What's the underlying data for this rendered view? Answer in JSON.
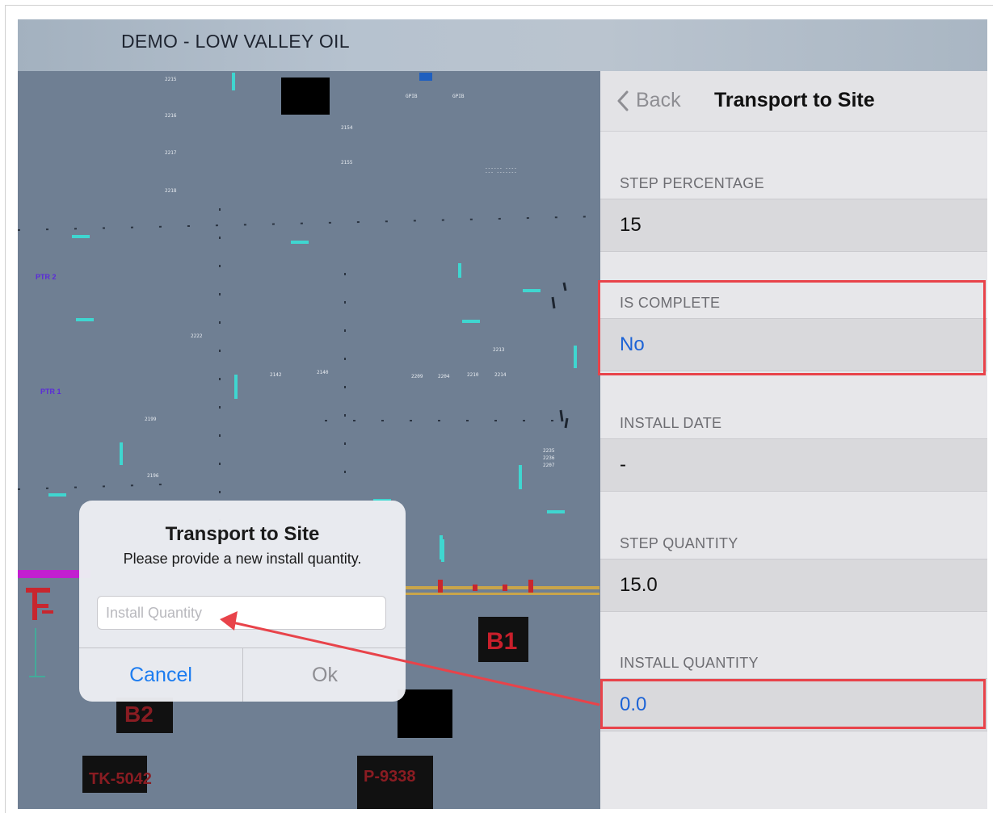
{
  "app": {
    "title": "DEMO - LOW VALLEY OIL"
  },
  "nav": {
    "back_label": "Back",
    "title": "Transport to Site"
  },
  "sections": [
    {
      "header": "STEP PERCENTAGE",
      "value": "15"
    },
    {
      "header": "IS COMPLETE",
      "value": "No"
    },
    {
      "header": "INSTALL DATE",
      "value": "-"
    },
    {
      "header": "STEP QUANTITY",
      "value": "15.0"
    },
    {
      "header": "INSTALL QUANTITY",
      "value": "0.0"
    }
  ],
  "dialog": {
    "title": "Transport to Site",
    "message": "Please provide a new install quantity.",
    "input_placeholder": "Install Quantity",
    "cancel_label": "Cancel",
    "ok_label": "Ok"
  },
  "map_labels": {
    "ptr2": "PTR 2",
    "ptr1": "PTR 1",
    "b1": "B1",
    "b2": "B2",
    "tk": "TK-5042",
    "p": "P-9338"
  },
  "colors": {
    "link": "#1c63d6",
    "highlight": "#e8434a",
    "map_background": "#6f7f93",
    "cyan_marker": "#3fd6d0",
    "tag_text": "#c81f2b",
    "ptr_text": "#5b2bd9"
  }
}
